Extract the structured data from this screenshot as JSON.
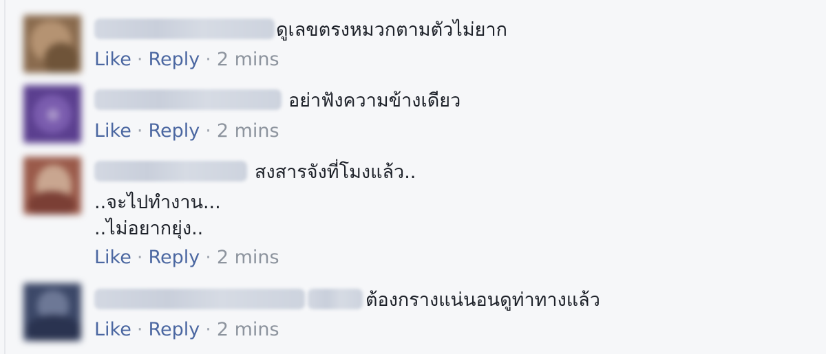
{
  "comments": [
    {
      "text": "ดูเลขตรงหมวกตามตัวไม่ยาก",
      "extra_lines": [],
      "actions": {
        "like": "Like",
        "reply": "Reply",
        "time": "2 mins"
      },
      "avatar_colors": [
        "#8a6b4e",
        "#b59372",
        "#6f5439"
      ]
    },
    {
      "text": "อย่าฟังความข้างเดียว",
      "extra_lines": [],
      "actions": {
        "like": "Like",
        "reply": "Reply",
        "time": "2 mins"
      },
      "avatar_colors": [
        "#5b3f8f",
        "#7a5cae",
        "#43306e"
      ]
    },
    {
      "text": "สงสารจังที่โมงแล้ว..",
      "extra_lines": [
        "..จะไปทำงาน...",
        "..ไม่อยากยุ่ง.."
      ],
      "actions": {
        "like": "Like",
        "reply": "Reply",
        "time": "2 mins"
      },
      "avatar_colors": [
        "#9a5a4a",
        "#c9a690",
        "#7b3f35"
      ]
    },
    {
      "text": "ต้องกรางแน่นอนดูท่าทางแล้ว",
      "extra_lines": [],
      "actions": {
        "like": "Like",
        "reply": "Reply",
        "time": "2 mins"
      },
      "avatar_colors": [
        "#3c4868",
        "#6d7896",
        "#2a3350"
      ]
    }
  ],
  "colors": {
    "background": "#f6f7f9",
    "link": "#4b67a1",
    "meta": "#8d949e",
    "text": "#1d2129"
  }
}
